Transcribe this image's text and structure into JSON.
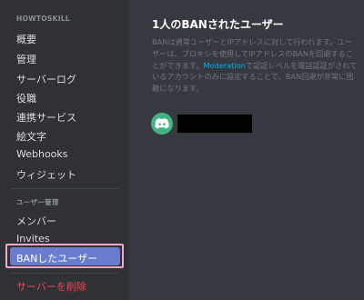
{
  "sidebar": {
    "server_name": "HOWTOSKILL",
    "items": [
      "概要",
      "管理",
      "サーバーログ",
      "役職",
      "連携サービス",
      "絵文字",
      "Webhooks",
      "ウィジェット"
    ],
    "section2_header": "ユーザー管理",
    "items2": [
      "メンバー",
      "Invites"
    ],
    "selected": "BANしたユーザー",
    "delete": "サーバーを削除"
  },
  "main": {
    "title": "1人のBANされたユーザー",
    "desc_part1": "BANは通常ユーザーとIPアドレスに対して行われます。ユーザーは、プロキシを使用してIPアドレスのBANを回避することができます。",
    "desc_link": "Moderation",
    "desc_part2": "で認証レベルを電話認証がされているアカウントのみに設定することで、BAN回避が非常に困難になります。"
  },
  "colors": {
    "accent": "#6a7cce",
    "danger": "#f04747",
    "link": "#00b0f4",
    "avatar": "#43b581",
    "highlight_border": "#f3a7c6"
  }
}
